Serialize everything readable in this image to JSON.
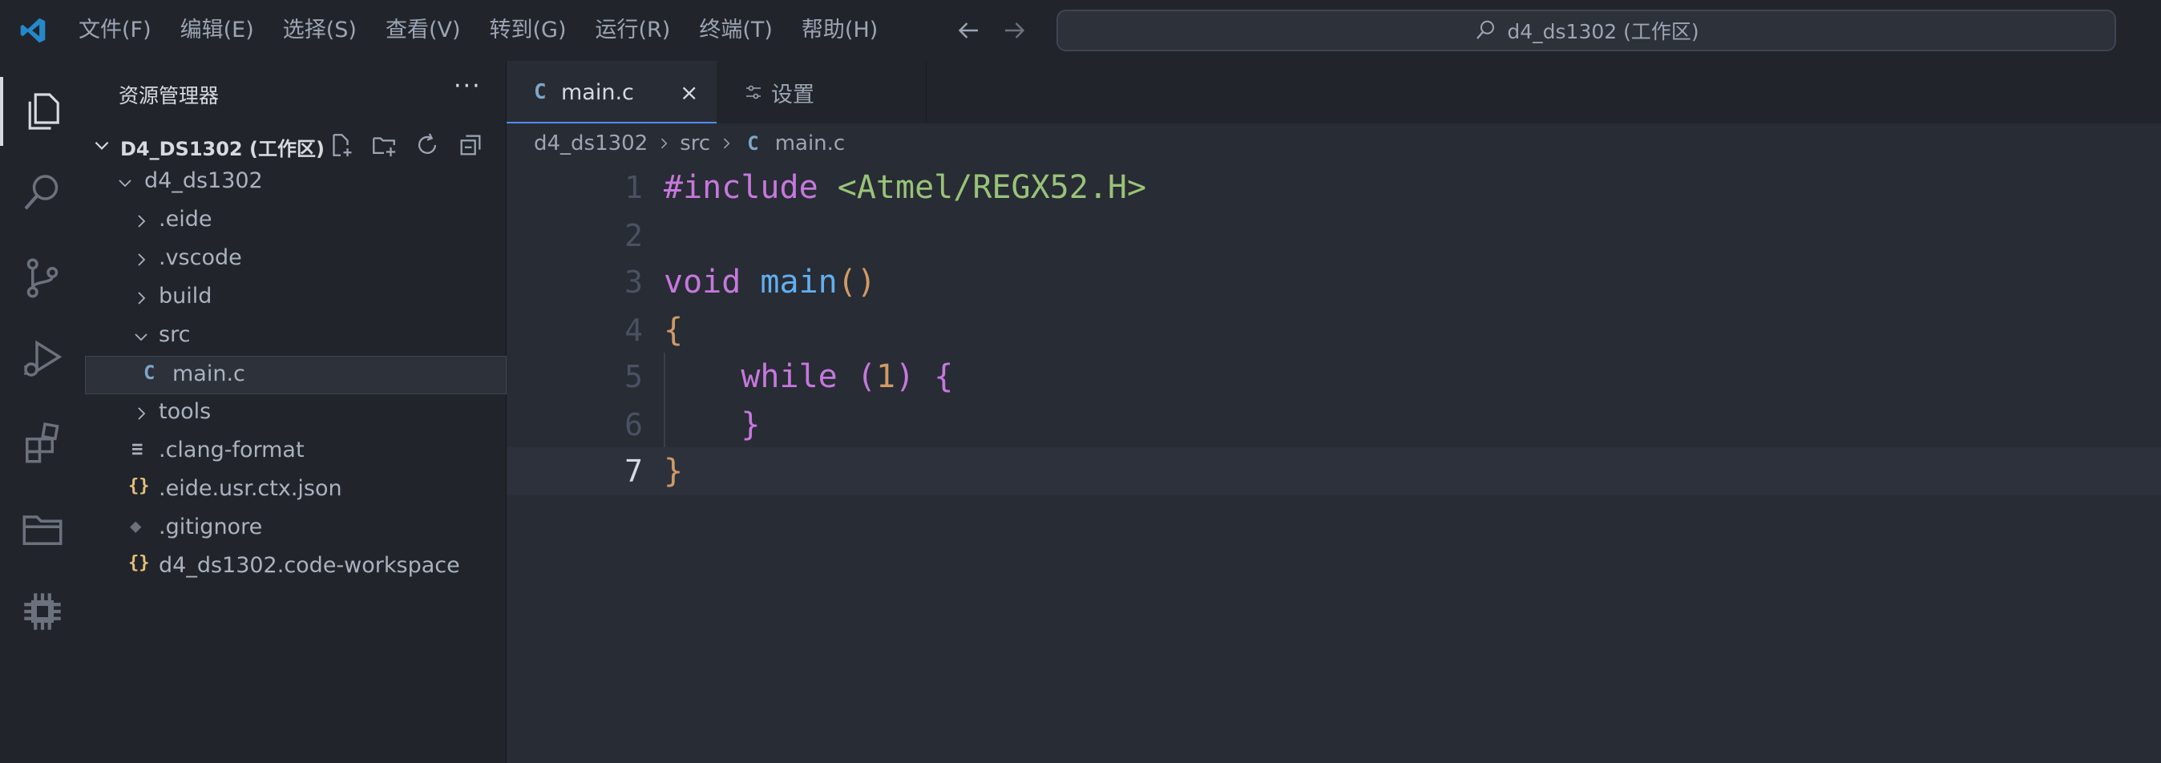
{
  "menu": [
    "文件(F)",
    "编辑(E)",
    "选择(S)",
    "查看(V)",
    "转到(G)",
    "运行(R)",
    "终端(T)",
    "帮助(H)"
  ],
  "command_center": "d4_ds1302 (工作区)",
  "sidebar": {
    "title": "资源管理器",
    "more": "···",
    "workspace_label": "D4_DS1302 (工作区)",
    "tree": [
      {
        "label": "d4_ds1302",
        "kind": "folder-open"
      },
      {
        "label": ".eide",
        "kind": "folder"
      },
      {
        "label": ".vscode",
        "kind": "folder"
      },
      {
        "label": "build",
        "kind": "folder"
      },
      {
        "label": "src",
        "kind": "folder-open"
      },
      {
        "label": "main.c",
        "kind": "c-file",
        "icon": "C"
      },
      {
        "label": "tools",
        "kind": "folder"
      },
      {
        "label": ".clang-format",
        "kind": "lines-file",
        "icon": "≡"
      },
      {
        "label": ".eide.usr.ctx.json",
        "kind": "json-file",
        "icon": "{}"
      },
      {
        "label": ".gitignore",
        "kind": "git-file",
        "icon": "◆"
      },
      {
        "label": "d4_ds1302.code-workspace",
        "kind": "json-file",
        "icon": "{}"
      }
    ]
  },
  "tabs": {
    "active": {
      "icon": "C",
      "label": "main.c",
      "close": "×"
    },
    "settings": {
      "label": "设置"
    }
  },
  "breadcrumb": {
    "root": "d4_ds1302",
    "folder": "src",
    "file_icon": "C",
    "file": "main.c"
  },
  "editor": {
    "line_numbers": [
      "1",
      "2",
      "3",
      "4",
      "5",
      "6",
      "7"
    ],
    "current_line": 7,
    "code": {
      "l1_directive": "#include",
      "l1_header": "<Atmel/REGX52.H>",
      "l3_type": "void",
      "l3_fn": "main",
      "l3_parens": "()",
      "l4_open": "{",
      "l5_kw": "while",
      "l5_open_paren": "(",
      "l5_num": "1",
      "l5_close_paren": ")",
      "l5_brace": "{",
      "l6_brace": "}",
      "l7_close": "}"
    }
  },
  "colors": {
    "background": "#282c34",
    "sidebar": "#21252b",
    "keyword": "#c678dd",
    "string": "#98c379",
    "function": "#61afef",
    "number": "#d19a66",
    "vscode_blue": "#2489ca"
  }
}
